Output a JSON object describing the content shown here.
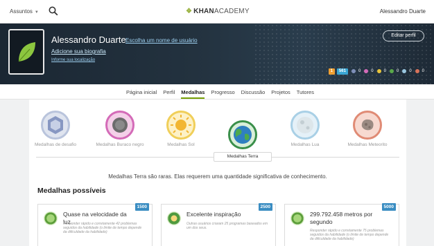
{
  "nav": {
    "subjects_label": "Assuntos",
    "logo_main": "KHAN",
    "logo_light": "ACADEMY",
    "user_name": "Alessandro Duarte"
  },
  "profile": {
    "name": "Alessandro Duarte",
    "username_link": "Escolha um nome de usuário",
    "bio_link": "Adicione sua biografia",
    "location_link": "Informe sua localização",
    "edit_button": "Editar perfil",
    "streak": "1",
    "points": "561",
    "medal_counts": [
      "0",
      "0",
      "0",
      "0",
      "0",
      "0"
    ],
    "medal_colors": [
      "#7e8fb8",
      "#d46bb8",
      "#e8c43a",
      "#5aa84a",
      "#9ac7e0",
      "#d9735a"
    ]
  },
  "tabs": [
    {
      "label": "Página inicial"
    },
    {
      "label": "Perfil"
    },
    {
      "label": "Medalhas"
    },
    {
      "label": "Progresso"
    },
    {
      "label": "Discussão"
    },
    {
      "label": "Projetos"
    },
    {
      "label": "Tutores"
    }
  ],
  "badge_types": [
    {
      "label": "Medalhas de desafio",
      "color": "#7e8fb8"
    },
    {
      "label": "Medalhas Buraco negro",
      "color": "#d46bb8"
    },
    {
      "label": "Medalhas Sol",
      "color": "#e8c43a"
    },
    {
      "label": "Medalhas Terra",
      "color": "#3a8f4a"
    },
    {
      "label": "Medalhas Lua",
      "color": "#9ac7e0"
    },
    {
      "label": "Medalhas Meteorito",
      "color": "#d9735a"
    }
  ],
  "selected_badge_label": "Medalhas Terra",
  "description": "Medalhas Terra são raras. Elas requerem uma quantidade significativa de conhecimento.",
  "section_title": "Medalhas possíveis",
  "possible_badges": [
    {
      "title": "Quase na velocidade da luz",
      "description": "Responder rápido e corretamente 42 problemas seguidos da habilidade (o limite de tempo depende da dificuldade da habilidade)",
      "points": "1500"
    },
    {
      "title": "Excelente inspiração",
      "description": "Outras usuários criaram 25 programas baseados em um dos seus.",
      "points": "2500"
    },
    {
      "title": "299.792.458 metros por segundo",
      "description": "Responder rápido e corretamente 75 problemas seguidos da habilidade (o limite de tempo depende da dificuldade da habilidade)",
      "points": "5000"
    }
  ]
}
